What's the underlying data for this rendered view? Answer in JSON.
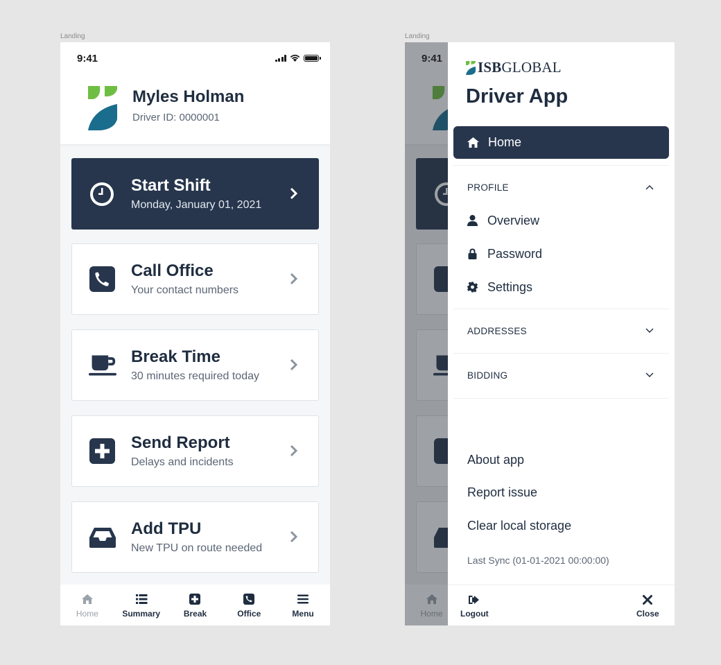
{
  "frames": {
    "left_label": "Landing",
    "right_label": "Landing"
  },
  "status_bar": {
    "time": "9:41"
  },
  "driver": {
    "name": "Myles Holman",
    "id_text": "Driver ID: 0000001"
  },
  "cards": [
    {
      "title": "Start Shift",
      "subtitle": "Monday, January 01, 2021",
      "icon": "clock-icon"
    },
    {
      "title": "Call Office",
      "subtitle": "Your contact numbers",
      "icon": "phone-icon"
    },
    {
      "title": "Break Time",
      "subtitle": "30 minutes required today",
      "icon": "coffee-cup-icon"
    },
    {
      "title": "Send Report",
      "subtitle": "Delays and incidents",
      "icon": "plus-square-icon"
    },
    {
      "title": "Add TPU",
      "subtitle": "New TPU on route needed",
      "icon": "inbox-tray-icon"
    }
  ],
  "bottom_nav": [
    {
      "label": "Home",
      "icon": "home-icon",
      "enabled": false
    },
    {
      "label": "Summary",
      "icon": "list-icon",
      "enabled": true
    },
    {
      "label": "Break",
      "icon": "plus-square-icon",
      "enabled": true
    },
    {
      "label": "Office",
      "icon": "phone-icon",
      "enabled": true
    },
    {
      "label": "Menu",
      "icon": "hamburger-icon",
      "enabled": true
    }
  ],
  "drawer": {
    "brand_bold": "ISB",
    "brand_rest": "GLOBAL",
    "title": "Driver App",
    "home_label": "Home",
    "profile": {
      "header": "PROFILE",
      "expanded": true,
      "items": [
        {
          "label": "Overview",
          "icon": "user-icon"
        },
        {
          "label": "Password",
          "icon": "lock-icon"
        },
        {
          "label": "Settings",
          "icon": "gear-icon"
        }
      ]
    },
    "addresses_header": "ADDRESSES",
    "bidding_header": "BIDDING",
    "links": [
      "About app",
      "Report issue",
      "Clear local storage"
    ],
    "last_sync": "Last Sync (01-01-2021 00:00:00)",
    "logout_label": "Logout",
    "close_label": "Close"
  },
  "colors": {
    "primary": "#27364d",
    "leaf_green": "#6fbe44",
    "leaf_teal": "#1a6d8c",
    "background": "#f4f6f8"
  }
}
